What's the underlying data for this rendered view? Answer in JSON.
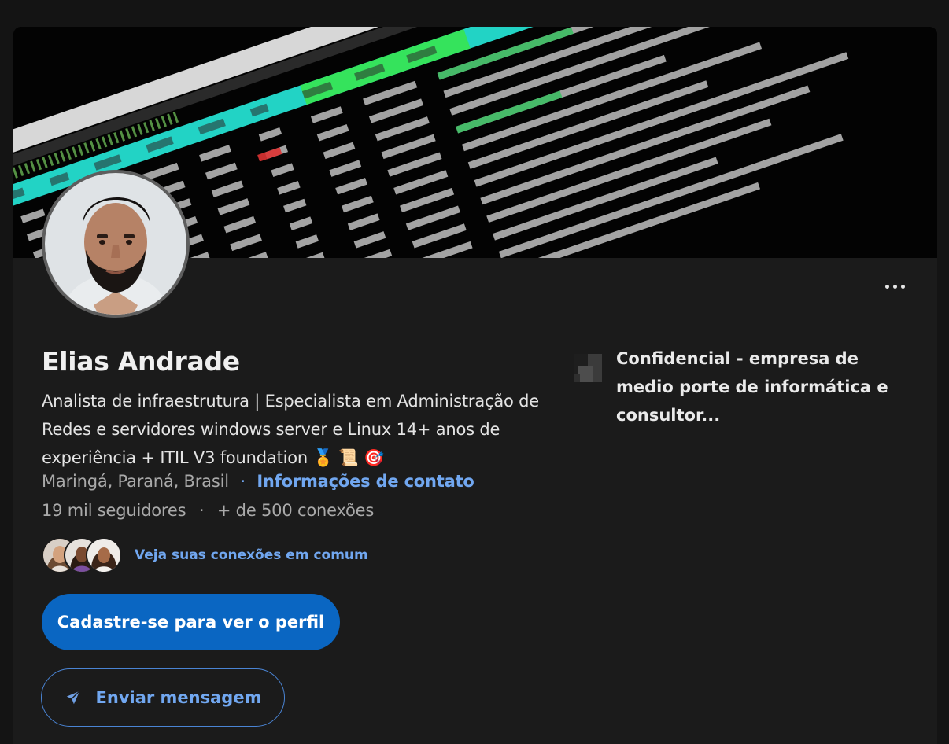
{
  "profile": {
    "name": "Elias Andrade",
    "headline": "Analista de infraestrutura | Especialista em Administração de Redes e servidores windows server e Linux 14+ anos de experiência + ITIL V3 foundation",
    "headline_emojis": "🏅 📜 🎯",
    "location": "Maringá, Paraná, Brasil",
    "location_separator": "·",
    "contact_link": "Informações de contato",
    "followers": "19 mil seguidores",
    "stats_separator": "·",
    "connections": "+ de 500 conexões",
    "mutual_link": "Veja suas conexões em comum"
  },
  "company": {
    "name": "Confidencial - empresa de medio porte de informática e consultor..."
  },
  "actions": {
    "signup_label": "Cadastre-se para ver o perfil",
    "message_label": "Enviar mensagem"
  },
  "icons": {
    "more": "ellipsis-icon",
    "send": "send-icon",
    "company_logo": "company-logo-icon"
  },
  "colors": {
    "background": "#141414",
    "card": "#1b1b1b",
    "primary_button": "#0a66c2",
    "link": "#71a7f0",
    "muted_text": "#a9a9a9"
  }
}
